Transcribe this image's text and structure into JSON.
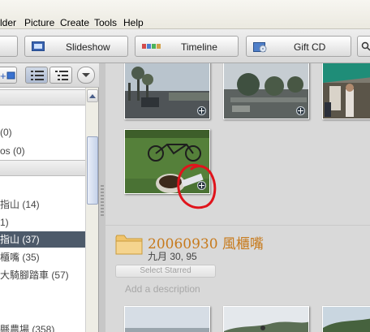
{
  "menubar": {
    "items": [
      {
        "label": "lder"
      },
      {
        "label": "Picture"
      },
      {
        "label": "Create"
      },
      {
        "label": "Tools"
      },
      {
        "label": "Help"
      }
    ]
  },
  "toolbar": {
    "slideshow_label": "Slideshow",
    "timeline_label": "Timeline",
    "giftcd_label": "Gift CD"
  },
  "sidebar": {
    "items": [
      {
        "label": "(0)"
      },
      {
        "label": "os (0)"
      },
      {
        "label": "指山 (14)"
      },
      {
        "label": "1)"
      },
      {
        "label": "指山 (37)"
      },
      {
        "label": "櫃嘴 (35)"
      },
      {
        "label": "大騎腳踏車 (57)"
      },
      {
        "label": "縣農場 (358)"
      }
    ]
  },
  "folder": {
    "title": "20060930 風櫃嘴",
    "date": "九月 30, 95",
    "select_starred": "Select Starred",
    "description_placeholder": "Add a description"
  },
  "colors": {
    "folder_title": "#c77a1c",
    "sidebar_selected": "#4d5a6a",
    "annotation": "#e0141c"
  }
}
